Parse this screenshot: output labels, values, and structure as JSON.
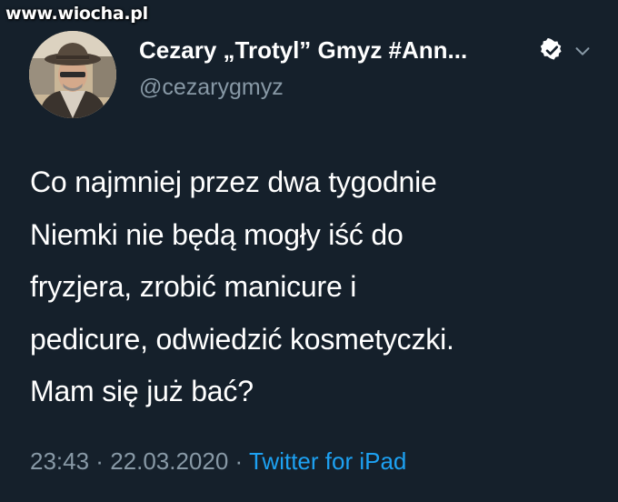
{
  "watermark": "www.wiocha.pl",
  "user": {
    "display_name": "Cezary „Trotyl” Gmyz #Ann...",
    "handle": "@cezarygmyz",
    "verified_icon": "verified-badge-icon",
    "menu_icon": "chevron-down-icon"
  },
  "tweet": {
    "lines": [
      "Co najmniej przez dwa tygodnie",
      "Niemki nie będą mogły iść do",
      "fryzjera, zrobić manicure i",
      "pedicure, odwiedzić kosmetyczki.",
      "Mam się już bać?"
    ]
  },
  "meta": {
    "time": "23:43",
    "separator": " · ",
    "date": "22.03.2020",
    "source": "Twitter for iPad"
  },
  "colors": {
    "background": "#15202b",
    "text": "#ffffff",
    "secondary": "#8899a6",
    "link": "#1da1f2"
  }
}
